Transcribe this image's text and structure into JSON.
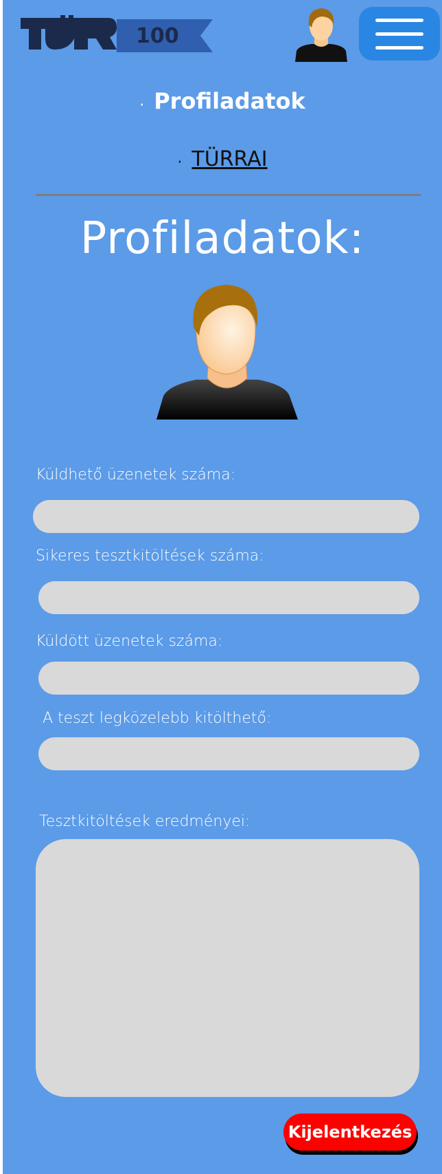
{
  "logo": {
    "text_primary": "TÜRR",
    "text_secondary": "100",
    "icon": "turr-100-logo"
  },
  "header": {
    "avatar_icon": "user-avatar-icon",
    "menu_icon": "hamburger-menu-icon"
  },
  "nav": {
    "items": [
      {
        "label": "Profiladatok",
        "active": true
      },
      {
        "label": "TÜRRAI",
        "active": false
      }
    ],
    "bullet": "·"
  },
  "page": {
    "title": "Profiladatok:"
  },
  "fields": [
    {
      "label": "Küldhető üzenetek száma:",
      "value": ""
    },
    {
      "label": "Sikeres tesztkitöltések száma:",
      "value": ""
    },
    {
      "label": "Küldött üzenetek száma:",
      "value": ""
    },
    {
      "label": "A teszt legközelebb kitölthető:",
      "value": ""
    }
  ],
  "results": {
    "label": "Tesztkitöltések eredményei:",
    "value": ""
  },
  "actions": {
    "logout_label": "Kijelentkezés"
  },
  "colors": {
    "background": "#5b9be8",
    "menu_button": "#2a86e3",
    "input": "#d9d9d9",
    "logout": "#ff0000",
    "logo_dark": "#1b2a4a",
    "logo_banner": "#2f5fae"
  }
}
